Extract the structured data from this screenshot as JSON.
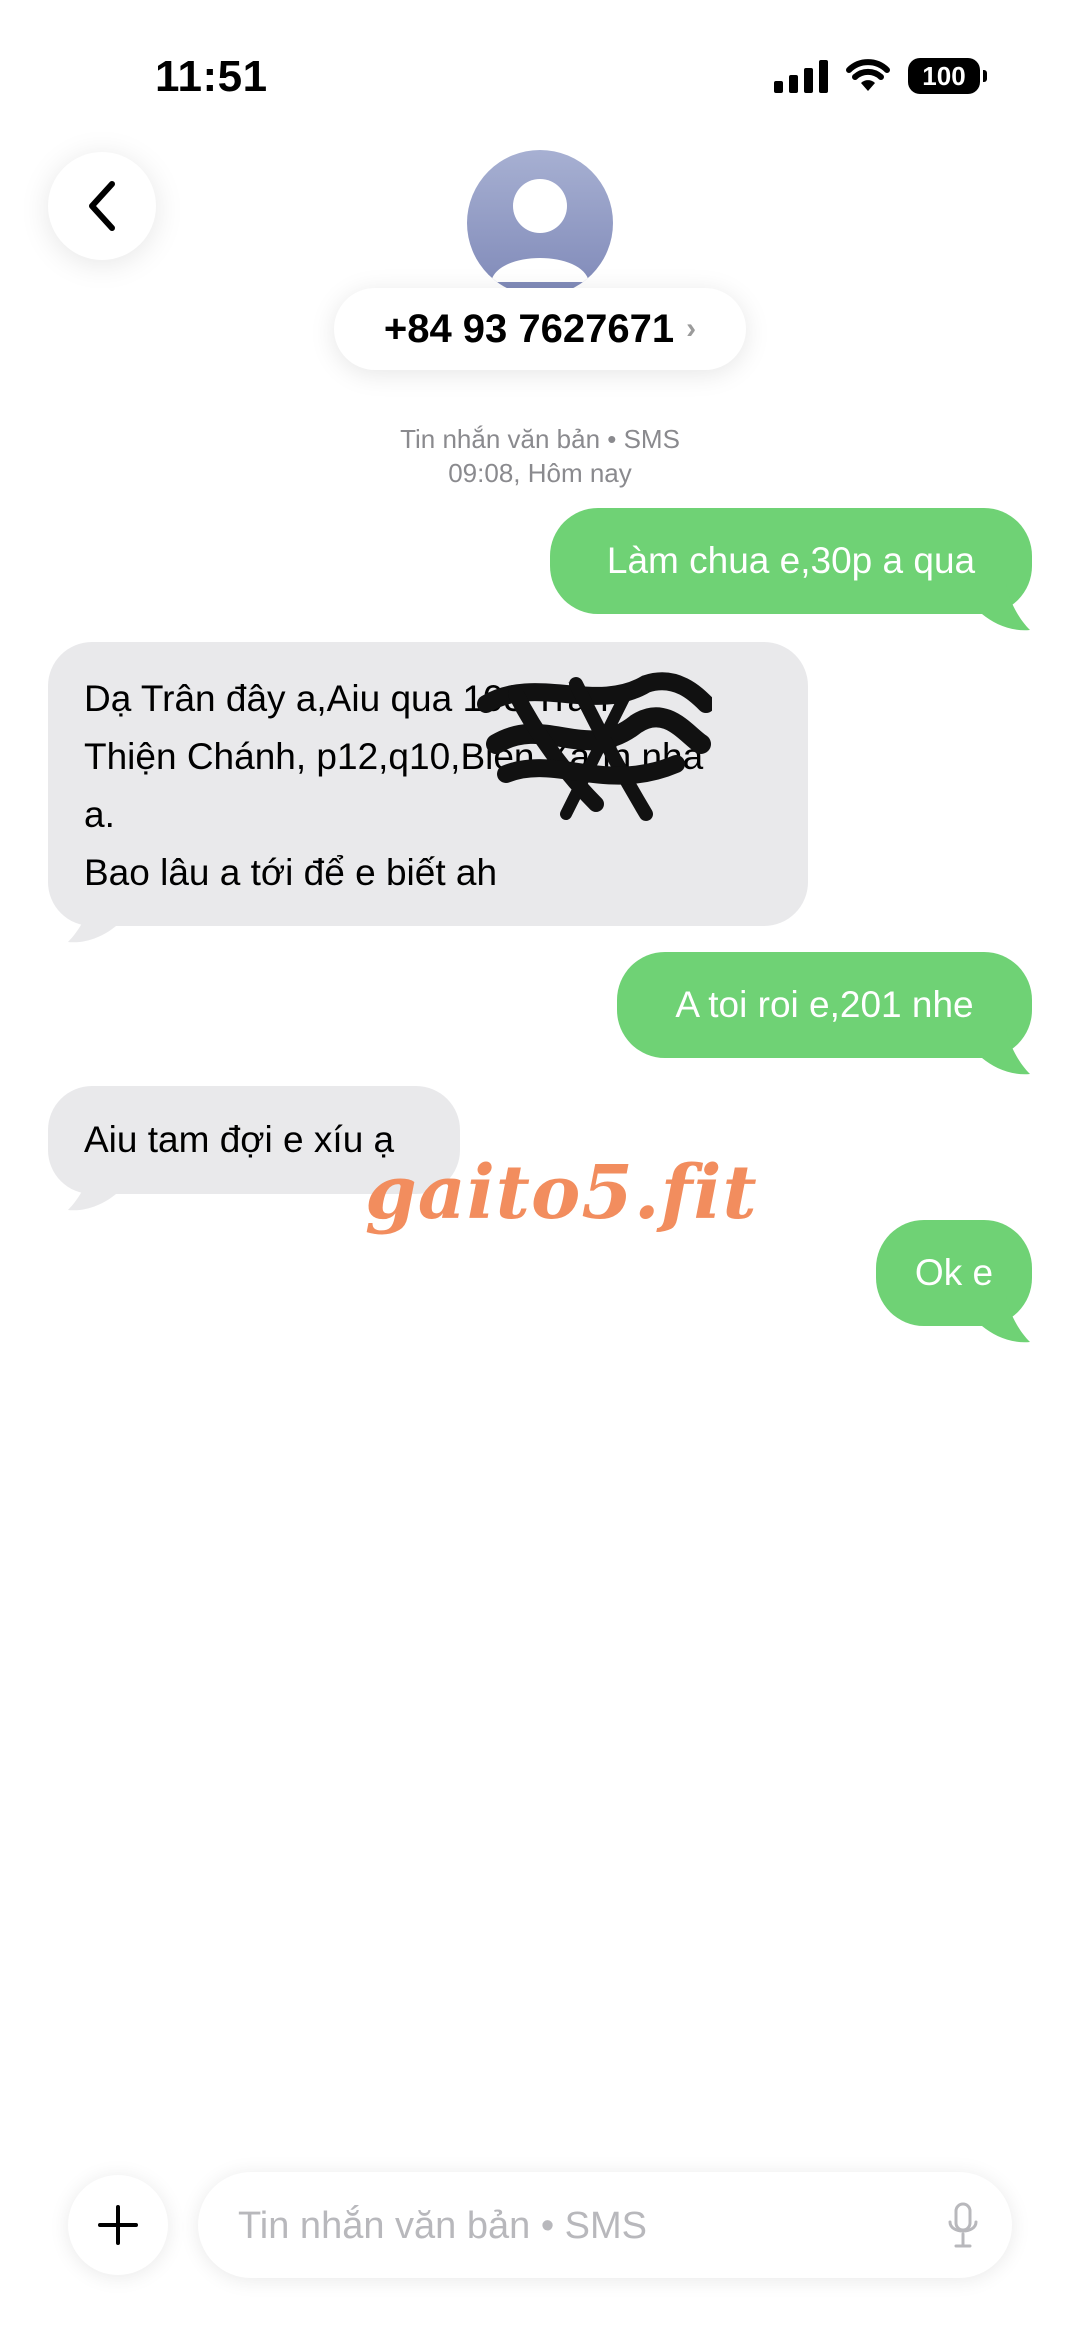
{
  "status_bar": {
    "time": "11:51",
    "battery": "100"
  },
  "contact": {
    "phone": "+84 93 7627671",
    "chevron": "›"
  },
  "meta": {
    "channel": "Tin nhắn văn bản • SMS",
    "timestamp": "09:08, Hôm nay"
  },
  "messages": [
    {
      "direction": "outgoing",
      "lines": [
        "Làm chua e,30p a qua"
      ]
    },
    {
      "direction": "incoming",
      "lines": [
        "Dạ Trân đây a,Aiu qua 103 Trần",
        "Thiện Chánh, p12,q10,Biển Xanh nha",
        "a.",
        "Bao lâu a tới để e biết ah"
      ]
    },
    {
      "direction": "outgoing",
      "lines": [
        "A toi roi e,201 nhe"
      ]
    },
    {
      "direction": "incoming",
      "lines": [
        "Aiu tam đợi e xíu ạ"
      ]
    },
    {
      "direction": "outgoing",
      "lines": [
        "Ok e"
      ]
    }
  ],
  "watermark": "gaito5.fit",
  "composer": {
    "placeholder": "Tin nhắn văn bản • SMS",
    "plus_icon": "plus-icon",
    "mic_icon": "microphone-icon"
  },
  "colors": {
    "outgoing_bubble": "#6fd275",
    "incoming_bubble": "#e9e9eb",
    "watermark": "#f28d5e"
  }
}
